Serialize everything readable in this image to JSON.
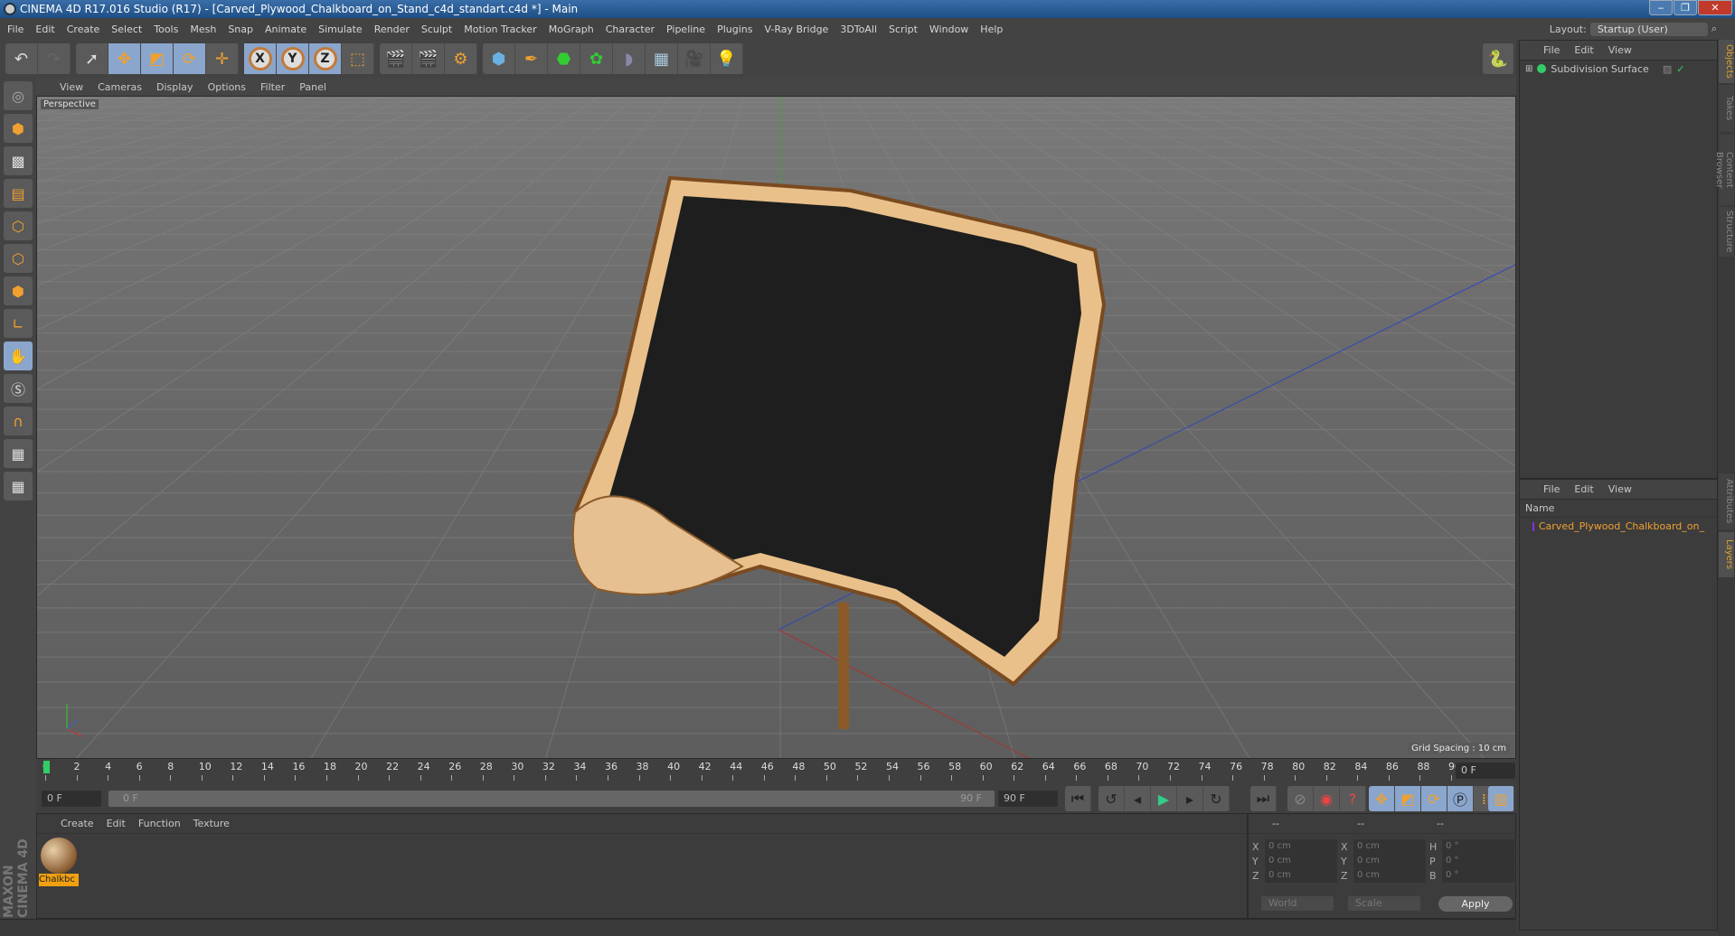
{
  "window": {
    "title": "CINEMA 4D R17.016 Studio (R17) - [Carved_Plywood_Chalkboard_on_Stand_c4d_standart.c4d *] - Main"
  },
  "menu": [
    "File",
    "Edit",
    "Create",
    "Select",
    "Tools",
    "Mesh",
    "Snap",
    "Animate",
    "Simulate",
    "Render",
    "Sculpt",
    "Motion Tracker",
    "MoGraph",
    "Character",
    "Pipeline",
    "Plugins",
    "V-Ray Bridge",
    "3DToAll",
    "Script",
    "Window",
    "Help"
  ],
  "layout": {
    "label": "Layout:",
    "value": "Startup (User)"
  },
  "toolbar": {
    "axes": [
      "X",
      "Y",
      "Z"
    ]
  },
  "viewport": {
    "menu": [
      "View",
      "Cameras",
      "Display",
      "Options",
      "Filter",
      "Panel"
    ],
    "camera": "Perspective",
    "grid_spacing": "Grid Spacing : 10 cm"
  },
  "timeline": {
    "start": 0,
    "end": 90,
    "step": 2,
    "current_frame": "0 F",
    "start_field": "0 F",
    "range_start": "0 F",
    "range_end": "90 F",
    "end_field": "90 F"
  },
  "materials": {
    "menu": [
      "Create",
      "Edit",
      "Function",
      "Texture"
    ],
    "items": [
      {
        "name": "Chalkbc"
      }
    ]
  },
  "coordinates": {
    "headers": [
      "--",
      "--",
      "--"
    ],
    "rows": [
      {
        "a": "X",
        "v1": "0 cm",
        "b": "X",
        "v2": "0 cm",
        "c": "H",
        "v3": "0 °"
      },
      {
        "a": "Y",
        "v1": "0 cm",
        "b": "Y",
        "v2": "0 cm",
        "c": "P",
        "v3": "0 °"
      },
      {
        "a": "Z",
        "v1": "0 cm",
        "b": "Z",
        "v2": "0 cm",
        "c": "B",
        "v3": "0 °"
      }
    ],
    "mode": "World",
    "transform": "Scale",
    "apply": "Apply"
  },
  "objects": {
    "menu": [
      "File",
      "Edit",
      "View"
    ],
    "items": [
      {
        "name": "Subdivision Surface"
      }
    ]
  },
  "layers": {
    "menu": [
      "File",
      "Edit",
      "View"
    ],
    "column": "Name",
    "items": [
      {
        "name": "Carved_Plywood_Chalkboard_on_",
        "color": "#8a2be2"
      }
    ]
  },
  "right_tabs": [
    "Objects",
    "Takes",
    "Content Browser",
    "Structure",
    "Attributes",
    "Layers"
  ],
  "brand": "MAXON CINEMA 4D",
  "colors": {
    "accent": "#f0a030",
    "selection": "#8aa6cc"
  }
}
